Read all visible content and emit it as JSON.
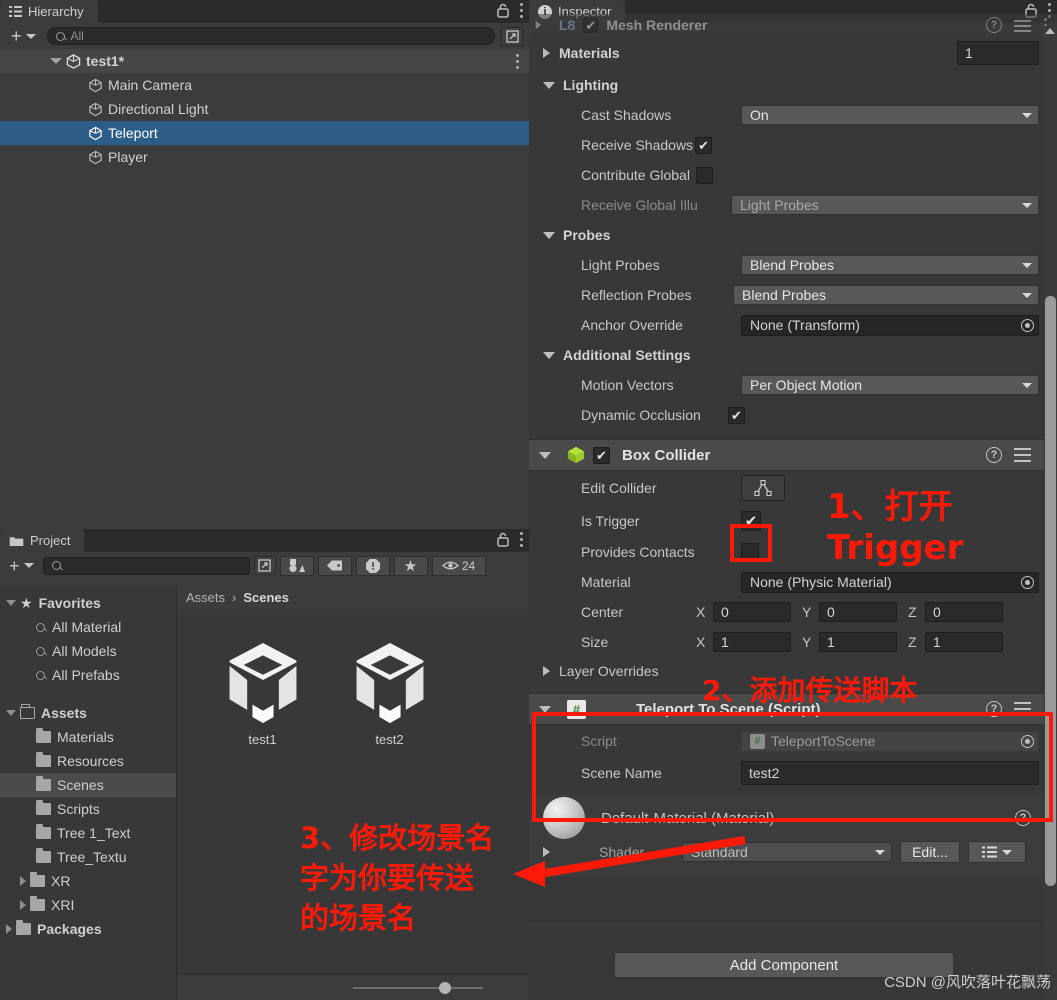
{
  "hierarchy": {
    "tab_label": "Hierarchy",
    "add_label": "+",
    "search_placeholder": "All",
    "items": [
      {
        "label": "test1*",
        "depth": 0,
        "selected": false,
        "root": true
      },
      {
        "label": "Main Camera",
        "depth": 1,
        "selected": false
      },
      {
        "label": "Directional Light",
        "depth": 1,
        "selected": false
      },
      {
        "label": "Teleport",
        "depth": 1,
        "selected": true
      },
      {
        "label": "Player",
        "depth": 1,
        "selected": false
      }
    ]
  },
  "project": {
    "tab_label": "Project",
    "search_placeholder": "",
    "visible_count": "24",
    "breadcrumb": {
      "root": "Assets",
      "separator": "›",
      "current": "Scenes"
    },
    "favorites": {
      "label": "Favorites",
      "items": [
        "All Material",
        "All Models",
        "All Prefabs"
      ]
    },
    "assets": {
      "label": "Assets",
      "items": [
        {
          "label": "Materials",
          "expandable": false,
          "selected": false
        },
        {
          "label": "Resources",
          "expandable": false,
          "selected": false
        },
        {
          "label": "Scenes",
          "expandable": false,
          "selected": true
        },
        {
          "label": "Scripts",
          "expandable": false,
          "selected": false
        },
        {
          "label": "Tree 1_Text",
          "expandable": false,
          "selected": false
        },
        {
          "label": "Tree_Textu",
          "expandable": false,
          "selected": false
        },
        {
          "label": "XR",
          "expandable": true,
          "selected": false
        },
        {
          "label": "XRI",
          "expandable": true,
          "selected": false
        }
      ]
    },
    "packages": {
      "label": "Packages"
    },
    "grid_items": [
      {
        "label": "test1"
      },
      {
        "label": "test2"
      }
    ]
  },
  "inspector": {
    "tab_label": "Inspector",
    "cut_component_title": "Mesh Renderer",
    "mesh_renderer": {
      "materials_label": "Materials",
      "materials_count": "1",
      "lighting_label": "Lighting",
      "cast_shadows_label": "Cast Shadows",
      "cast_shadows_value": "On",
      "receive_shadows_label": "Receive Shadows",
      "receive_shadows_checked": true,
      "contribute_global_label": "Contribute Global",
      "contribute_global_checked": false,
      "receive_gi_label": "Receive Global Illu",
      "receive_gi_value": "Light Probes",
      "probes_label": "Probes",
      "light_probes_label": "Light Probes",
      "light_probes_value": "Blend Probes",
      "reflection_probes_label": "Reflection Probes",
      "reflection_probes_value": "Blend Probes",
      "anchor_override_label": "Anchor Override",
      "anchor_override_value": "None (Transform)",
      "additional_settings_label": "Additional Settings",
      "motion_vectors_label": "Motion Vectors",
      "motion_vectors_value": "Per Object Motion",
      "dynamic_occlusion_label": "Dynamic Occlusion",
      "dynamic_occlusion_checked": true
    },
    "box_collider": {
      "title": "Box Collider",
      "enabled": true,
      "edit_collider_label": "Edit Collider",
      "is_trigger_label": "Is Trigger",
      "is_trigger_checked": true,
      "provides_contacts_label": "Provides Contacts",
      "provides_contacts_checked": false,
      "material_label": "Material",
      "material_value": "None (Physic Material)",
      "center_label": "Center",
      "center": {
        "x": "0",
        "y": "0",
        "z": "0"
      },
      "size_label": "Size",
      "size": {
        "x": "1",
        "y": "1",
        "z": "1"
      },
      "layer_overrides_label": "Layer Overrides",
      "axis_x": "X",
      "axis_y": "Y",
      "axis_z": "Z"
    },
    "teleport_script": {
      "title": "Teleport To Scene (Script)",
      "script_label": "Script",
      "script_value": "TeleportToScene",
      "scene_name_label": "Scene Name",
      "scene_name_value": "test2"
    },
    "material": {
      "title": "Default-Material (Material)",
      "shader_label": "Shader",
      "shader_value": "Standard",
      "edit_label": "Edit..."
    },
    "add_component_label": "Add Component"
  },
  "annotations": {
    "step1_line1": "1、打开",
    "step1_line2": "Trigger",
    "step2": "2、添加传送脚本",
    "step3_line1": "3、修改场景名",
    "step3_line2": "字为你要传送",
    "step3_line3": "的场景名",
    "accent_color": "#fe1a09"
  },
  "watermark": "CSDN @风吹落叶花飘荡"
}
